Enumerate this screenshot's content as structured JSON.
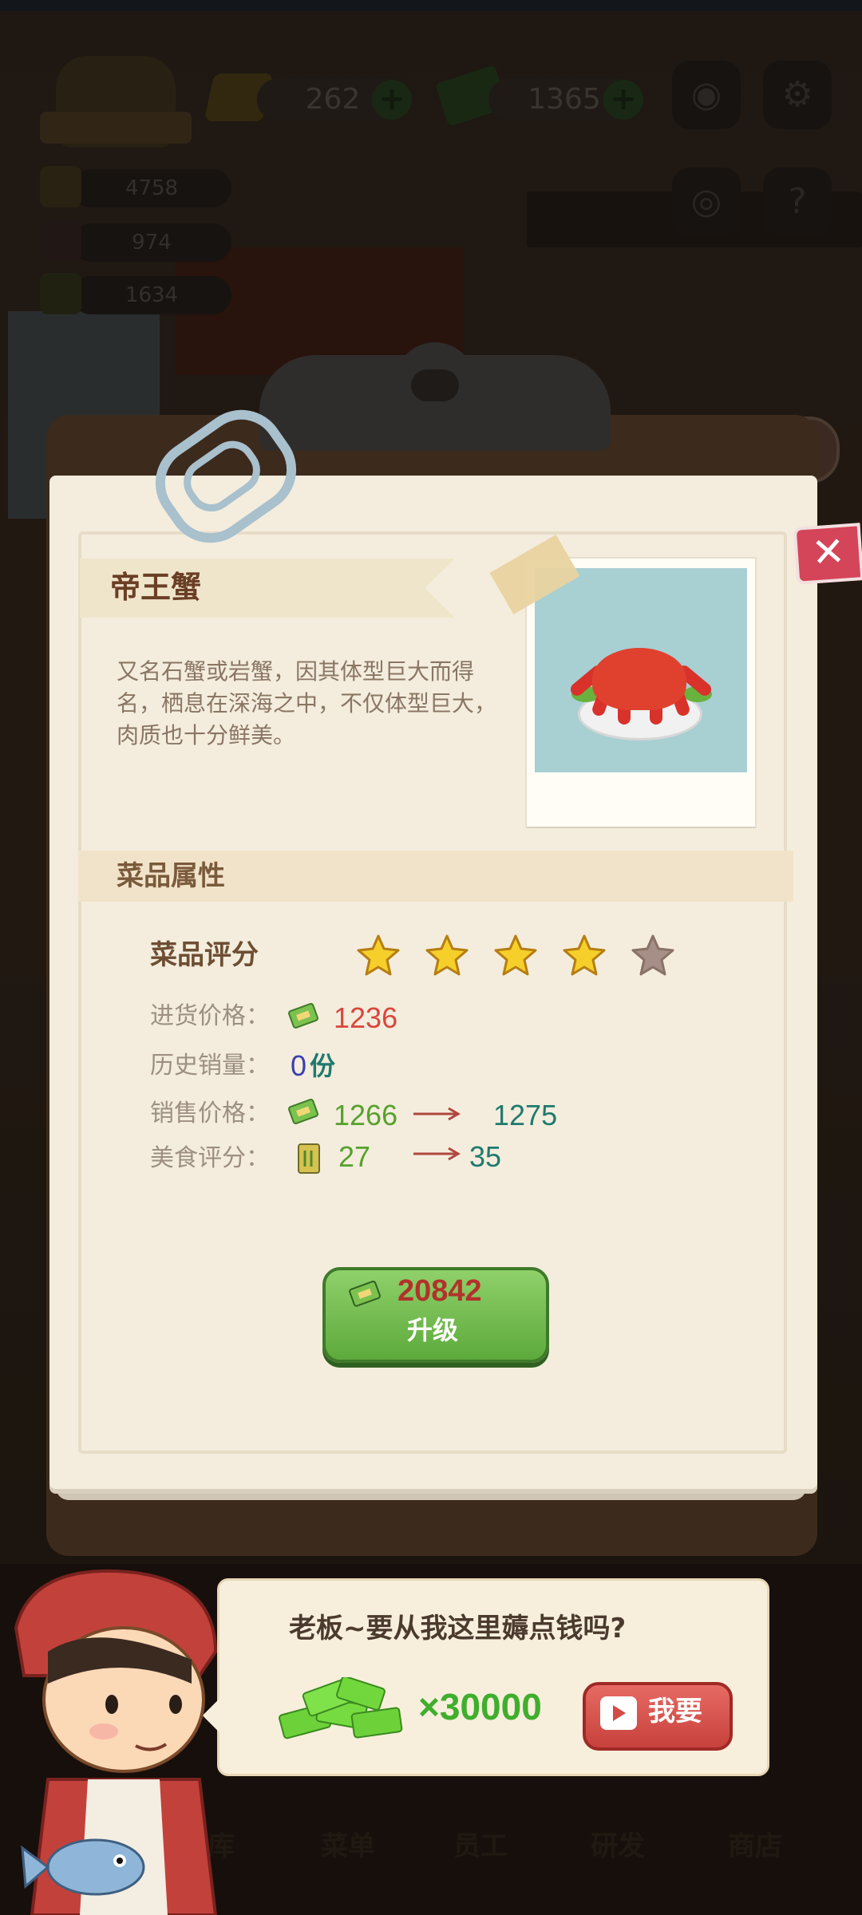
{
  "hud": {
    "gems": "262",
    "cash": "1365",
    "stats": [
      "4758",
      "974",
      "1634"
    ]
  },
  "dish": {
    "name": "帝王蟹",
    "description": "又名石蟹或岩蟹，因其体型巨大而得名，栖息在深海之中，不仅体型巨大，肉质也十分鲜美。",
    "section_title": "菜品属性",
    "rating_label": "菜品评分",
    "rating": {
      "filled": 4,
      "total": 5
    },
    "purchase_price_label": "进货价格：",
    "purchase_price": "1236",
    "sales_history_label": "历史销量：",
    "sales_history_count": "0",
    "sales_history_unit": "份",
    "sale_price_label": "销售价格：",
    "sale_price_current": "1266",
    "sale_price_next": "1275",
    "food_score_label": "美食评分：",
    "food_score_current": "27",
    "food_score_next": "35"
  },
  "upgrade": {
    "cost": "20842",
    "label": "升级"
  },
  "offer": {
    "message": "老板~要从我这里薅点钱吗?",
    "reward": "×30000",
    "button_label": "我要"
  },
  "bottom_nav": [
    "仓库",
    "菜单",
    "员工",
    "研发",
    "商店"
  ],
  "colors": {
    "purchase_price": "#d9463c",
    "sale_price_current": "#56a12c",
    "next_value": "#1f7a6e",
    "count_zero": "#3a3fb0",
    "count_unit": "#1f7a6e",
    "star_filled": "#f6cf2b",
    "star_empty": "#a58f86"
  }
}
